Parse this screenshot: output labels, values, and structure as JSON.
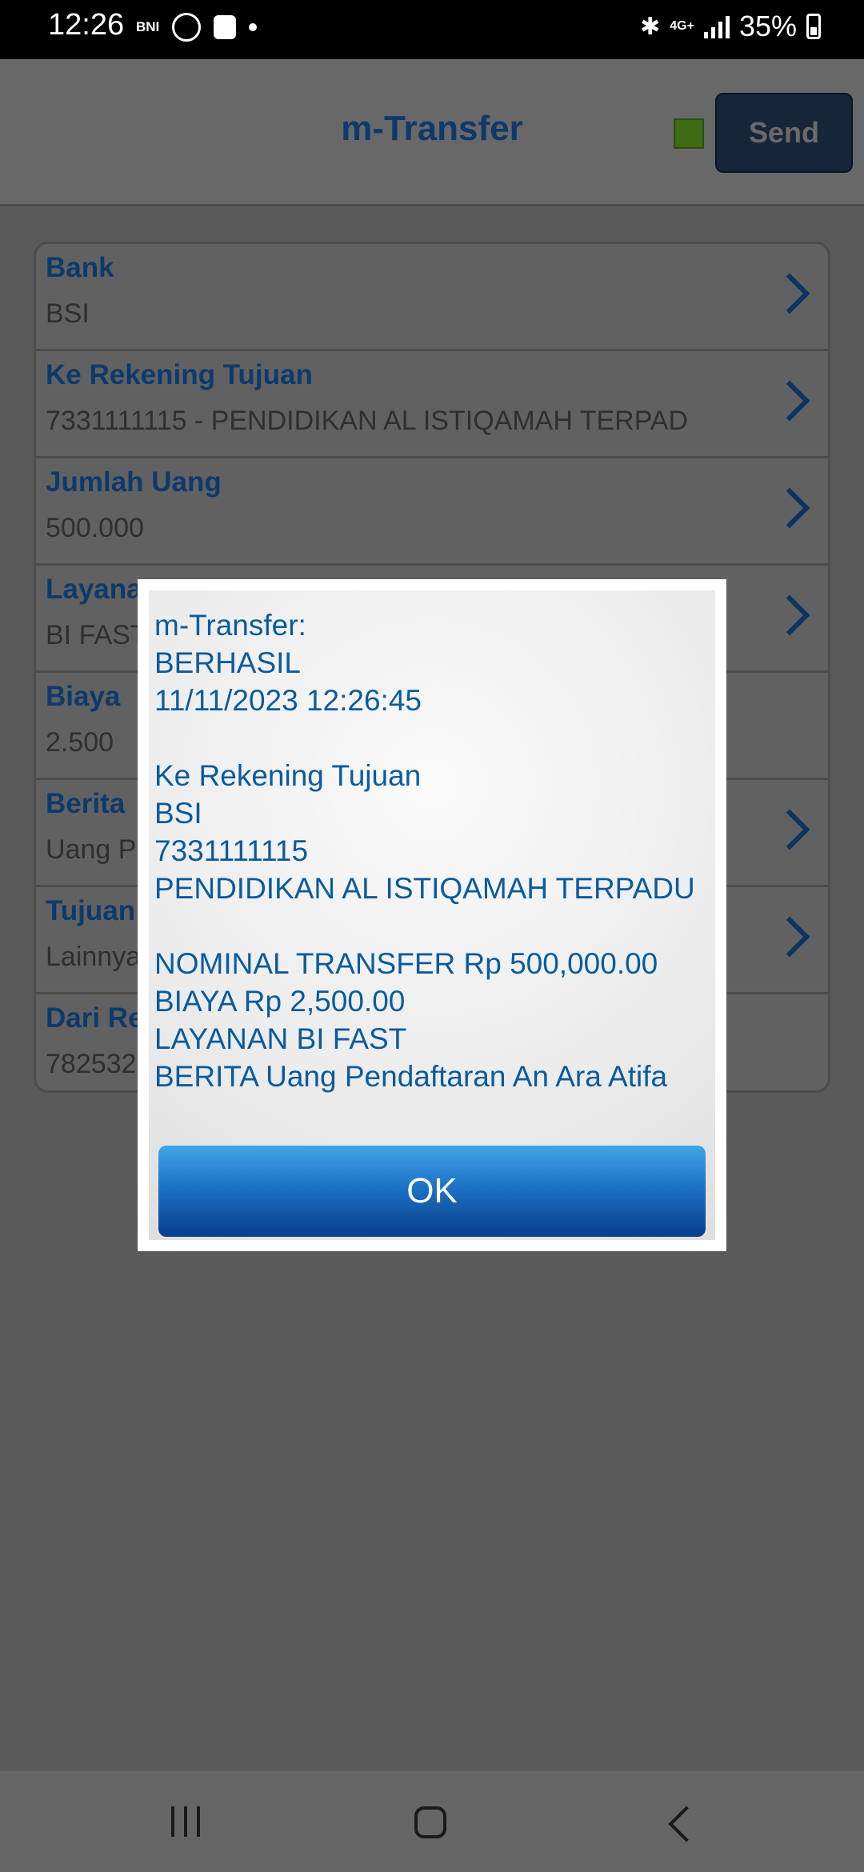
{
  "status_bar": {
    "time": "12:26",
    "bni_label": "BNI",
    "network": "4G+",
    "battery": "35%"
  },
  "header": {
    "title": "m-Transfer",
    "send_label": "Send",
    "status_color": "#3f6b15"
  },
  "form": {
    "rows": [
      {
        "label": "Bank",
        "value": "BSI"
      },
      {
        "label": "Ke Rekening Tujuan",
        "value": "7331111115 - PENDIDIKAN AL ISTIQAMAH TERPAD"
      },
      {
        "label": "Jumlah Uang",
        "value": "500.000"
      },
      {
        "label": "Layana",
        "value": "BI FAST"
      },
      {
        "label": "Biaya",
        "value": "2.500"
      },
      {
        "label": "Berita",
        "value": "Uang P"
      },
      {
        "label": "Tujuan",
        "value": "Lainnya"
      },
      {
        "label": "Dari Re",
        "value": "782532"
      }
    ]
  },
  "dialog": {
    "lines": [
      "m-Transfer:",
      "BERHASIL",
      "11/11/2023 12:26:45",
      "",
      "Ke Rekening Tujuan",
      "BSI",
      "7331111115",
      "PENDIDIKAN AL ISTIQAMAH TERPADU",
      "",
      "NOMINAL TRANSFER Rp 500,000.00",
      "BIAYA Rp 2,500.00",
      "LAYANAN BI FAST",
      "BERITA Uang Pendaftaran An Ara Atifa"
    ],
    "ok_label": "OK"
  }
}
